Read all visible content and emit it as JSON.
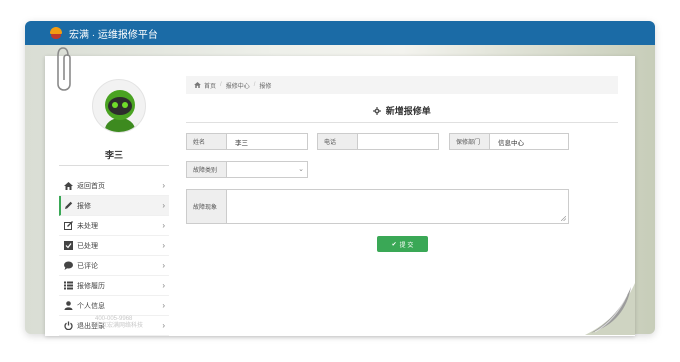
{
  "app": {
    "title": "宏满 · 运维报修平台"
  },
  "sidebar": {
    "user_name": "李三",
    "items": [
      {
        "label": "返回首页",
        "icon": "home-icon"
      },
      {
        "label": "报修",
        "icon": "pencil-icon"
      },
      {
        "label": "未处理",
        "icon": "edit-icon"
      },
      {
        "label": "已处理",
        "icon": "checked-icon"
      },
      {
        "label": "已评论",
        "icon": "comment-icon"
      },
      {
        "label": "报修履历",
        "icon": "list-icon"
      },
      {
        "label": "个人信息",
        "icon": "user-icon"
      },
      {
        "label": "退出登录",
        "icon": "power-icon"
      }
    ],
    "arrow": "›"
  },
  "watermark": {
    "line1": "400-005-9968",
    "line2": "北京宏满网络科技"
  },
  "breadcrumb": {
    "items": [
      "首页",
      "报修中心",
      "报修"
    ],
    "separator": "/"
  },
  "form": {
    "title": "新增报修单",
    "name_label": "姓名",
    "name_value": "李三",
    "phone_label": "电话",
    "phone_value": "",
    "dept_label": "保修部门",
    "dept_value": "信息中心",
    "fault_type_label": "故障类别",
    "fault_type_value": "",
    "phenomenon_label": "故障现象",
    "phenomenon_value": "",
    "submit_label": "提 交"
  },
  "colors": {
    "topbar": "#1b6ba6",
    "accent": "#3aa856"
  }
}
